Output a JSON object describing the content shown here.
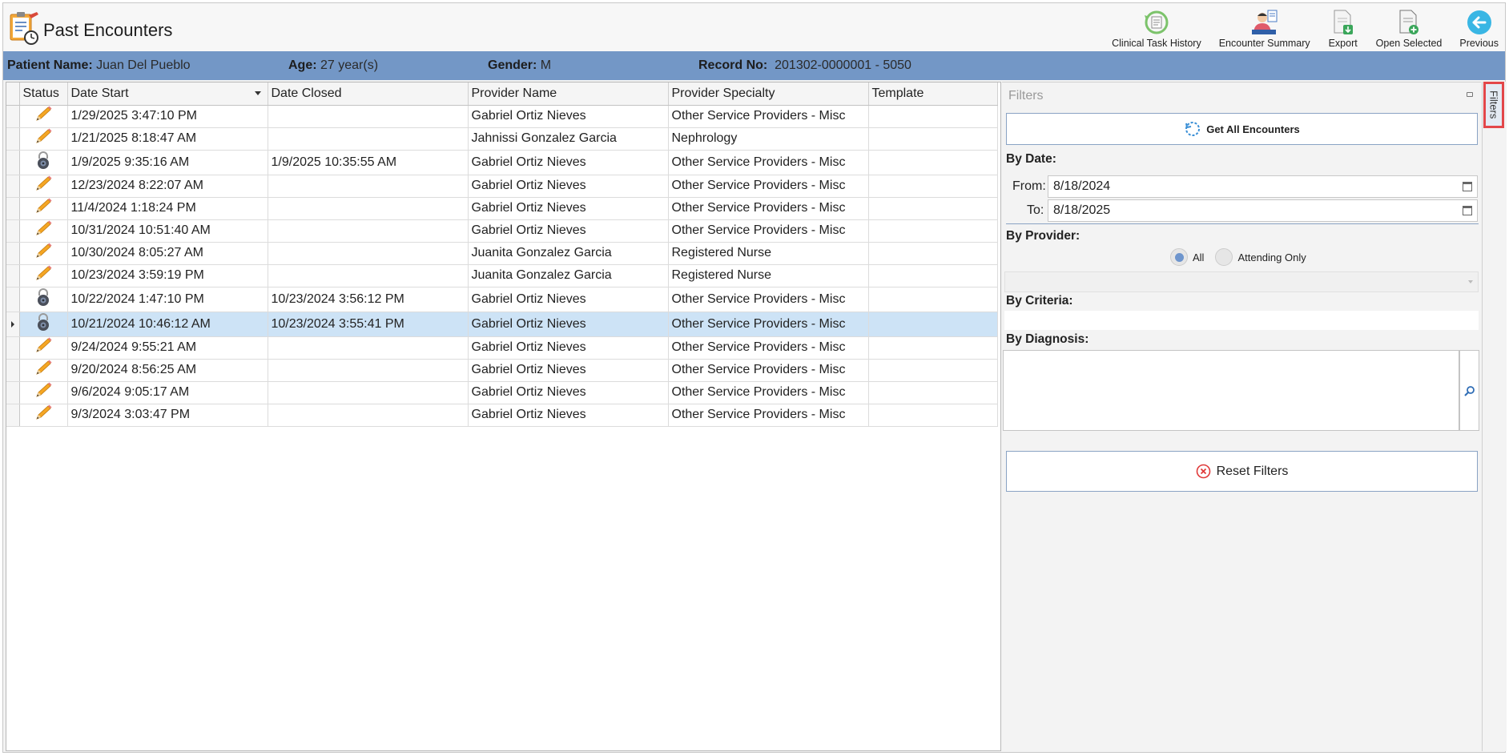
{
  "header": {
    "title": "Past Encounters",
    "toolbar": [
      {
        "label": "Clinical Task History",
        "icon": "clinical-task-history-icon"
      },
      {
        "label": "Encounter Summary",
        "icon": "encounter-summary-icon"
      },
      {
        "label": "Export",
        "icon": "export-icon"
      },
      {
        "label": "Open Selected",
        "icon": "open-selected-icon"
      },
      {
        "label": "Previous",
        "icon": "previous-arrow-icon"
      }
    ]
  },
  "patient": {
    "name_label": "Patient Name:",
    "name": "Juan Del Pueblo",
    "age_label": "Age:",
    "age": "27 year(s)",
    "gender_label": "Gender:",
    "gender": "M",
    "record_label": "Record No:",
    "record": "201302-0000001 - 5050"
  },
  "grid": {
    "columns": [
      "Status",
      "Date Start",
      "Date Closed",
      "Provider Name",
      "Provider Specialty",
      "Template"
    ],
    "rows": [
      {
        "status": "open",
        "date_start": "1/29/2025 3:47:10 PM",
        "date_closed": "",
        "provider": "Gabriel Ortiz Nieves",
        "specialty": "Other Service Providers - Misc",
        "template": ""
      },
      {
        "status": "open",
        "date_start": "1/21/2025 8:18:47 AM",
        "date_closed": "",
        "provider": "Jahnissi Gonzalez Garcia",
        "specialty": "Nephrology",
        "template": ""
      },
      {
        "status": "locked",
        "date_start": "1/9/2025 9:35:16 AM",
        "date_closed": "1/9/2025 10:35:55 AM",
        "provider": "Gabriel Ortiz Nieves",
        "specialty": "Other Service Providers - Misc",
        "template": ""
      },
      {
        "status": "open",
        "date_start": "12/23/2024 8:22:07 AM",
        "date_closed": "",
        "provider": "Gabriel Ortiz Nieves",
        "specialty": "Other Service Providers - Misc",
        "template": ""
      },
      {
        "status": "open",
        "date_start": "11/4/2024 1:18:24 PM",
        "date_closed": "",
        "provider": "Gabriel Ortiz Nieves",
        "specialty": "Other Service Providers - Misc",
        "template": ""
      },
      {
        "status": "open",
        "date_start": "10/31/2024 10:51:40 AM",
        "date_closed": "",
        "provider": "Gabriel Ortiz Nieves",
        "specialty": "Other Service Providers - Misc",
        "template": ""
      },
      {
        "status": "open",
        "date_start": "10/30/2024 8:05:27 AM",
        "date_closed": "",
        "provider": "Juanita Gonzalez Garcia",
        "specialty": "Registered Nurse",
        "template": ""
      },
      {
        "status": "open",
        "date_start": "10/23/2024 3:59:19 PM",
        "date_closed": "",
        "provider": "Juanita Gonzalez Garcia",
        "specialty": "Registered Nurse",
        "template": ""
      },
      {
        "status": "locked",
        "date_start": "10/22/2024 1:47:10 PM",
        "date_closed": "10/23/2024 3:56:12 PM",
        "provider": "Gabriel Ortiz Nieves",
        "specialty": "Other Service Providers - Misc",
        "template": ""
      },
      {
        "status": "locked",
        "date_start": "10/21/2024 10:46:12 AM",
        "date_closed": "10/23/2024 3:55:41 PM",
        "provider": "Gabriel Ortiz Nieves",
        "specialty": "Other Service Providers - Misc",
        "template": "",
        "selected": true
      },
      {
        "status": "open",
        "date_start": "9/24/2024 9:55:21 AM",
        "date_closed": "",
        "provider": "Gabriel Ortiz Nieves",
        "specialty": "Other Service Providers - Misc",
        "template": ""
      },
      {
        "status": "open",
        "date_start": "9/20/2024 8:56:25 AM",
        "date_closed": "",
        "provider": "Gabriel Ortiz Nieves",
        "specialty": "Other Service Providers - Misc",
        "template": ""
      },
      {
        "status": "open",
        "date_start": "9/6/2024 9:05:17 AM",
        "date_closed": "",
        "provider": "Gabriel Ortiz Nieves",
        "specialty": "Other Service Providers - Misc",
        "template": ""
      },
      {
        "status": "open",
        "date_start": "9/3/2024 3:03:47 PM",
        "date_closed": "",
        "provider": "Gabriel Ortiz Nieves",
        "specialty": "Other Service Providers - Misc",
        "template": ""
      }
    ]
  },
  "filters": {
    "title": "Filters",
    "get_all_label": "Get All Encounters",
    "by_date_label": "By Date:",
    "from_label": "From:",
    "from_value": "8/18/2024",
    "to_label": "To:",
    "to_value": "8/18/2025",
    "by_provider_label": "By Provider:",
    "radio_all": "All",
    "radio_attending": "Attending Only",
    "by_criteria_label": "By Criteria:",
    "by_diagnosis_label": "By Diagnosis:",
    "reset_label": "Reset Filters",
    "side_tab_label": "Filters"
  },
  "colors": {
    "patient_bar": "#7397c6",
    "selected_row": "#cde3f6",
    "accent_border": "#8aa3c4",
    "side_tab_highlight": "#e3474a"
  }
}
